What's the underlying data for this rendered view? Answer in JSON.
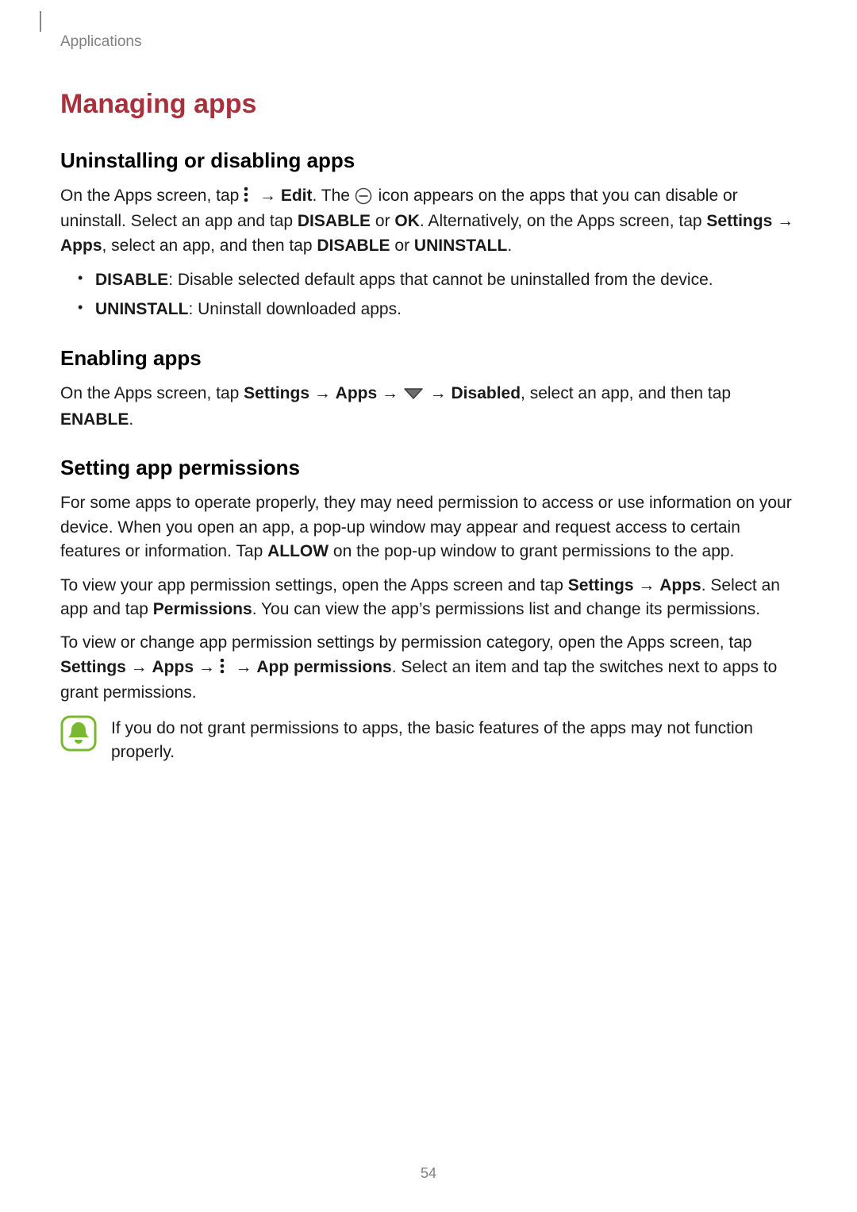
{
  "header": {
    "breadcrumb": "Applications"
  },
  "title": "Managing apps",
  "sections": {
    "uninstall": {
      "heading": "Uninstalling or disabling apps",
      "p1_a": "On the Apps screen, tap ",
      "p1_b": " → ",
      "p1_edit": "Edit",
      "p1_c": ". The ",
      "p1_d": " icon appears on the apps that you can disable or uninstall. Select an app and tap ",
      "disable": "DISABLE",
      "or": " or ",
      "ok": "OK",
      "p1_e": ". Alternatively, on the Apps screen, tap ",
      "settings": "Settings",
      "arrow": " → ",
      "apps": "Apps",
      "p1_f": ", select an app, and then tap ",
      "uninstall": "UNINSTALL",
      "period": ".",
      "li1_b": "DISABLE",
      "li1_t": ": Disable selected default apps that cannot be uninstalled from the device.",
      "li2_b": "UNINSTALL",
      "li2_t": ": Uninstall downloaded apps."
    },
    "enable": {
      "heading": "Enabling apps",
      "p_a": "On the Apps screen, tap ",
      "settings": "Settings",
      "arrow": " → ",
      "apps": "Apps",
      "p_b": " → ",
      "p_c": " → ",
      "disabled": "Disabled",
      "p_d": ", select an app, and then tap ",
      "enable": "ENABLE",
      "period": "."
    },
    "perm": {
      "heading": "Setting app permissions",
      "p1": "For some apps to operate properly, they may need permission to access or use information on your device. When you open an app, a pop-up window may appear and request access to certain features or information. Tap ",
      "allow": "ALLOW",
      "p1_b": " on the pop-up window to grant permissions to the app.",
      "p2_a": "To view your app permission settings, open the Apps screen and tap ",
      "settings": "Settings",
      "arrow": " → ",
      "apps": "Apps",
      "p2_b": ". Select an app and tap ",
      "permissions": "Permissions",
      "p2_c": ". You can view the app’s permissions list and change its permissions.",
      "p3_a": "To view or change app permission settings by permission category, open the Apps screen, tap ",
      "p3_b": " → ",
      "app_permissions": "App permissions",
      "p3_c": ". Select an item and tap the switches next to apps to grant permissions.",
      "note": "If you do not grant permissions to apps, the basic features of the apps may not function properly."
    }
  },
  "page_number": "54"
}
